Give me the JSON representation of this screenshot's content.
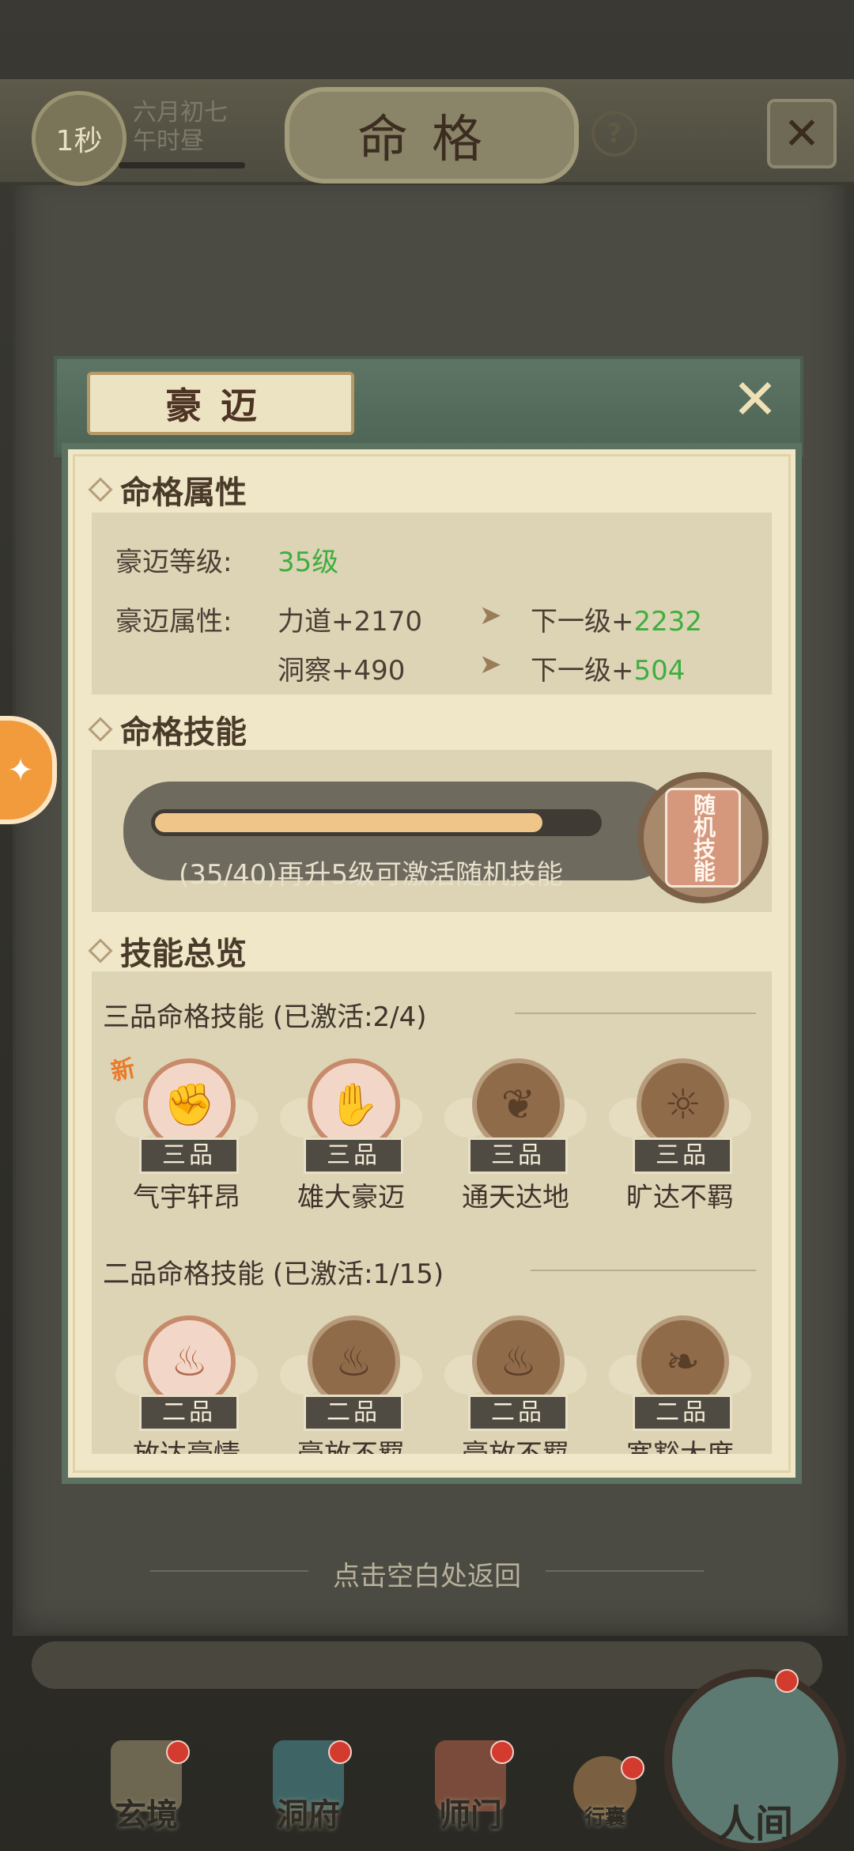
{
  "top": {
    "timer": "1秒",
    "date_line1": "六月初七",
    "date_line2": "午时昼",
    "page_title": "命格",
    "help": "?",
    "close": "✕"
  },
  "modal": {
    "title": "豪迈",
    "close": "✕",
    "attributes": {
      "heading": "命格属性",
      "level_label": "豪迈等级:",
      "level_value": "35级",
      "attr_label": "豪迈属性:",
      "rows": [
        {
          "current": "力道+2170",
          "next_label": "下一级+",
          "next_value": "2232"
        },
        {
          "current": "洞察+490",
          "next_label": "下一级+",
          "next_value": "504"
        }
      ]
    },
    "skill": {
      "heading": "命格技能",
      "progress_text": "(35/40)再升5级可激活随机技能",
      "progress_current": 35,
      "progress_max": 40,
      "random_skill_label": "随机技能"
    },
    "overview": {
      "heading": "技能总览",
      "tiers": [
        {
          "title": "三品命格技能",
          "status": "(已激活:2/4)",
          "skills": [
            {
              "grade": "三品",
              "name": "气宇轩昂",
              "active": true,
              "new": "新",
              "icon": "fist-icon"
            },
            {
              "grade": "三品",
              "name": "雄大豪迈",
              "active": true,
              "new": "",
              "icon": "arm-icon"
            },
            {
              "grade": "三品",
              "name": "通天达地",
              "active": false,
              "new": "",
              "icon": "tree-icon"
            },
            {
              "grade": "三品",
              "name": "旷达不羁",
              "active": false,
              "new": "",
              "icon": "sun-icon"
            }
          ]
        },
        {
          "title": "二品命格技能",
          "status": "(已激活:1/15)",
          "skills": [
            {
              "grade": "二品",
              "name": "放达豪情",
              "active": true,
              "new": "",
              "icon": "flame-icon"
            },
            {
              "grade": "二品",
              "name": "豪放不羁",
              "active": false,
              "new": "",
              "icon": "fire-icon"
            },
            {
              "grade": "二品",
              "name": "豪放不羁",
              "active": false,
              "new": "",
              "icon": "fire-icon"
            },
            {
              "grade": "二品",
              "name": "宽豁大度",
              "active": false,
              "new": "",
              "icon": "feather-icon"
            }
          ]
        }
      ]
    }
  },
  "return_hint": "点击空白处返回",
  "nav": {
    "items": [
      {
        "label": "玄境"
      },
      {
        "label": "洞府"
      },
      {
        "label": "师门"
      },
      {
        "label": "行囊"
      },
      {
        "label": "人间"
      }
    ]
  },
  "colors": {
    "accent_green": "#3fae3f",
    "progress_fill": "#f0c58a"
  }
}
